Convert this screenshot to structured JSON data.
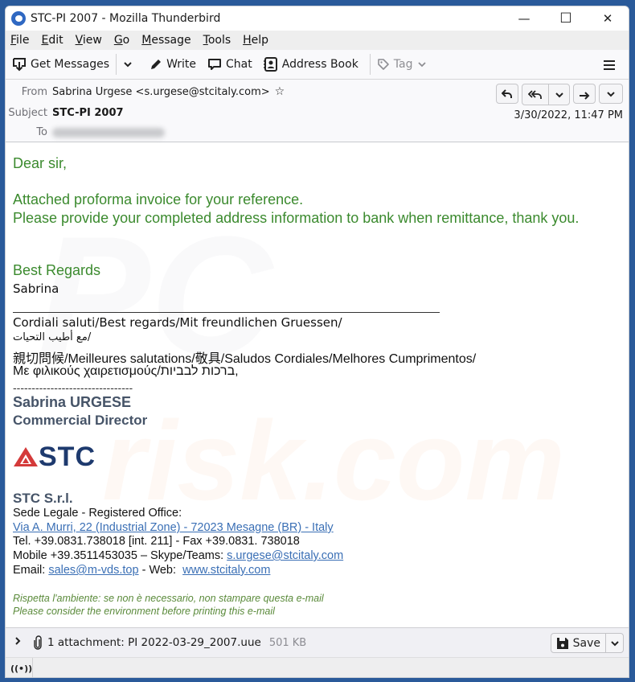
{
  "window": {
    "title": "STC-PI 2007 - Mozilla Thunderbird",
    "controls": {
      "minimize": "—",
      "maximize": "☐",
      "close": "✕"
    }
  },
  "menubar": {
    "items": [
      {
        "label": "File",
        "accel": "F",
        "rest": "ile"
      },
      {
        "label": "Edit",
        "accel": "E",
        "rest": "dit"
      },
      {
        "label": "View",
        "accel": "V",
        "rest": "iew"
      },
      {
        "label": "Go",
        "accel": "G",
        "rest": "o"
      },
      {
        "label": "Message",
        "accel": "M",
        "rest": "essage"
      },
      {
        "label": "Tools",
        "accel": "T",
        "rest": "ools"
      },
      {
        "label": "Help",
        "accel": "H",
        "rest": "elp"
      }
    ]
  },
  "toolbar": {
    "get_messages": "Get Messages",
    "write": "Write",
    "chat": "Chat",
    "address_book": "Address Book",
    "tag": "Tag",
    "icons": {
      "get_messages": "download-tray-icon",
      "write": "pencil-icon",
      "chat": "chat-bubble-icon",
      "address_book": "contact-card-icon",
      "tag": "tag-icon",
      "menu": "hamburger-menu-icon"
    }
  },
  "header": {
    "from_label": "From",
    "from_value": "Sabrina Urgese <s.urgese@stcitaly.com>",
    "subject_label": "Subject",
    "subject_value": "STC-PI 2007",
    "to_label": "To",
    "to_value": "",
    "date": "3/30/2022, 11:47 PM",
    "actions": [
      "reply",
      "reply-all",
      "reply-all-menu",
      "forward",
      "more"
    ]
  },
  "body": {
    "greeting": "Dear sir,",
    "line1": "Attached proforma invoice for your reference.",
    "line2": "Please provide your completed address information to bank when remittance, thank you.",
    "closing": "Best Regards",
    "first_name": "Sabrina",
    "multilang": {
      "line1": "Cordiali saluti/Best regards/Mit freundlichen Gruessen/",
      "line2": "مع أطيب التحيات/",
      "line3": "親切問候/Meilleures salutations/敬具/Saludos Cordiales/Melhores Cumprimentos/",
      "line4": "Με φιλικούς χαιρετισμούς/ברכות לבביות,"
    },
    "dashes": "--------------------------------",
    "sig_name": "Sabrina URGESE",
    "sig_title": "Commercial Director",
    "logo_text": "STC",
    "company": "STC S.r.l.",
    "office_label": "Sede Legale - Registered Office:",
    "address_link": "Via A. Murri, 22 (Industrial Zone) - 72023 Mesagne (BR) - Italy",
    "tel": "Tel. +39.0831.738018 [int. 211] - Fax +39.0831. 738018",
    "mobile_prefix": "Mobile +39.3511453035 – Skype/Teams: ",
    "skype_link": "s.urgese@stcitaly.com",
    "email_prefix": "Email: ",
    "email_link": "sales@m-vds.top",
    "web_prefix": " - Web:  ",
    "web_link": "www.stcitaly.com",
    "footer_it": "Rispetta l'ambiente: se non è necessario, non stampare questa e-mail",
    "footer_en": "Please consider the environment before printing this e-mail",
    "watermark": "PC",
    "watermark2": "risk.com"
  },
  "attachment": {
    "summary": "1 attachment: PI 2022-03-29_2007.uue",
    "size": "501 KB",
    "save_label": "Save"
  },
  "colors": {
    "green_text": "#3b8a2e",
    "signature_gray": "#465468",
    "link": "#3a6fb5",
    "logo_red": "#d43a3a",
    "logo_navy": "#1e3a6e"
  }
}
